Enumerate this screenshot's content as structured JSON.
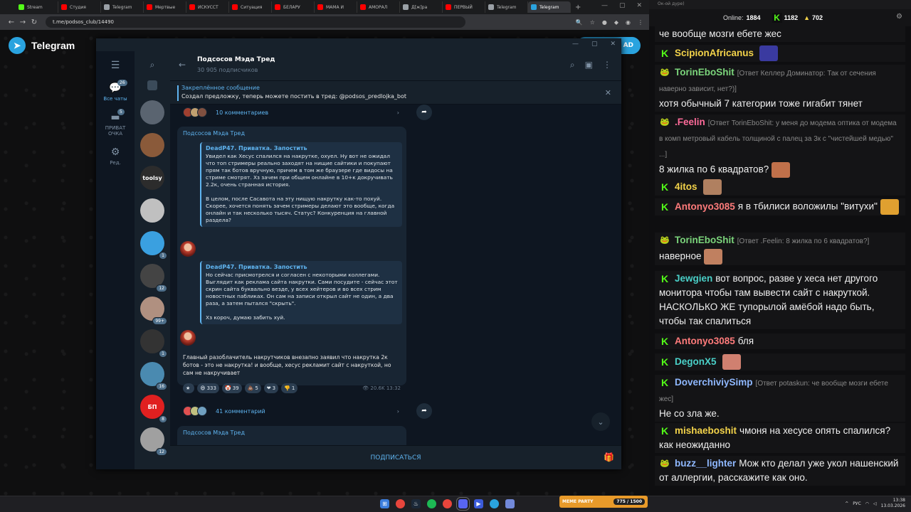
{
  "browser": {
    "tabs": [
      {
        "label": "Stream",
        "color": "#53fc18"
      },
      {
        "label": "Студия",
        "color": "#ff0000"
      },
      {
        "label": "Telegram",
        "color": "#9aa0a6"
      },
      {
        "label": "Мертвые",
        "color": "#ff0000"
      },
      {
        "label": "ИСКУССТ",
        "color": "#ff0000"
      },
      {
        "label": "Ситуация",
        "color": "#ff0000"
      },
      {
        "label": "БЕЛАРУ",
        "color": "#ff0000"
      },
      {
        "label": "МАМА И",
        "color": "#ff0000"
      },
      {
        "label": "АМОРАЛ",
        "color": "#ff0000"
      },
      {
        "label": "Д[ж]ра",
        "color": "#9aa0a6"
      },
      {
        "label": "ПЕРВЫЙ",
        "color": "#ff0000"
      },
      {
        "label": "Telegram",
        "color": "#9aa0a6"
      },
      {
        "label": "Telegram",
        "color": "#2aa3df"
      }
    ],
    "url": "t.me/podsos_club/14490"
  },
  "tg_page": {
    "logo_text": "Telegram",
    "download_label": "AD"
  },
  "folders": [
    {
      "label": "Все чаты",
      "icon": "chats-icon",
      "badge": "26"
    },
    {
      "label": "ПРИВАТ ОЧКА",
      "icon": "folder-icon",
      "badge": "5"
    },
    {
      "label": "Ред.",
      "icon": "edit-icon",
      "badge": ""
    }
  ],
  "chat_avatars": [
    {
      "color": "#5a6470",
      "badge": ""
    },
    {
      "color": "#8a5a3a",
      "badge": ""
    },
    {
      "color": "#2c2c2c",
      "badge": "",
      "text": "toolsy"
    },
    {
      "color": "#c0c0c0",
      "badge": ""
    },
    {
      "color": "#3aa0e0",
      "badge": "1"
    },
    {
      "color": "#444",
      "badge": "12"
    },
    {
      "color": "#b09080",
      "badge": "99+"
    },
    {
      "color": "#333",
      "badge": "1"
    },
    {
      "color": "#4a8ab0",
      "badge": "16"
    },
    {
      "color": "#e02020",
      "badge": "8",
      "text": "БП"
    },
    {
      "color": "#a0a0a0",
      "badge": "12"
    }
  ],
  "chat": {
    "title": "Подсосов Мэда Тред",
    "subscribers": "30 905 подписчиков",
    "pinned_label": "Закреплённое сообщение",
    "pinned_text": "Создал предложку, теперь можете  постить в тред: @podsos_predlojka_bot",
    "comments_top": "10 комментариев",
    "post": {
      "author": "Подсосов Мэда Тред",
      "quote1_author": "DeadP47. Приватка. Запостить",
      "quote1_text": "Увидел как Хесус спалился на накрутке, охуел. Ну вот не ожидал что топ стримеры реально заходят на нищие сайтики и покупают прям так ботов вручную, причем в том же браузере где видосы на стриме смотрят. Хз зачем при общем онлайне в 10+к докручивать 2.2к, очень странная история.\n\nВ целом, после Сасавота на эту нищую накрутку как-то похуй. Скорее, хочется понять зачем стримеры делают это вообще, когда онлайн и так несколько тысяч. Статус? Конкуренция на главной раздела?",
      "quote2_author": "DeadP47. Приватка. Запостить",
      "quote2_text": "Но сейчас присмотрелся и согласен с некоторыми коллегами. Выглядит как реклама сайта накрутки. Сами посудите - сейчас этот скрин сайта буквально везде, у всех хейтеров и во всех стрим новостных пабликах. Он сам на записи открыл сайт не один, а два раза, а затем пытался \"скрыть\".\n\nХз короч, думаю забить хуй.",
      "text": "Главный разоблачитель накрутчиков внезапно заявил что накрутка 2к ботов - это не накрутка! и вообще, хесус рекламит сайт с накруткой, но сам не накручивает",
      "reactions": [
        {
          "emoji": "★",
          "count": ""
        },
        {
          "emoji": "😄",
          "count": "333"
        },
        {
          "emoji": "🤡",
          "count": "39"
        },
        {
          "emoji": "💩",
          "count": "5"
        },
        {
          "emoji": "❤",
          "count": "3"
        },
        {
          "emoji": "👎",
          "count": "1"
        }
      ],
      "views": "20.6K",
      "time": "13:32",
      "comments": "41 комментарий"
    },
    "next_author": "Подсосов Мэда Тред",
    "subscribe_label": "ПОДПИСАТЬСЯ"
  },
  "streamchat": {
    "window_title": "Ок-ой дуре)",
    "online_label": "Online:",
    "online": "1884",
    "kick_count": "1182",
    "other_count": "702",
    "messages": [
      {
        "badge": "",
        "user": "",
        "user_color": "#fff",
        "reply": "",
        "text": "че вообще мозги ебете жес"
      },
      {
        "badge": "kick",
        "user": "ScipionAfricanus",
        "user_color": "#f3d34a",
        "reply": "",
        "text": ""
      },
      {
        "badge": "pepe",
        "user": "TorinEboShit",
        "user_color": "#7bd47b",
        "reply": "[Ответ Келлер Доминатор: Так от сечения наверно зависит, нет?)]",
        "text": "хотя обычный 7 категории тоже гигабит тянет"
      },
      {
        "badge": "pepe",
        "user": ".Feelin",
        "user_color": "#ff6b9a",
        "reply": "[Ответ TorinEboShit: у меня до модема оптика от модема в комп метровый кабель толщиной с палец за 3к с \"чистейшей медью\" ...]",
        "text": "8 жилка по 6 квадратов?"
      },
      {
        "badge": "kick",
        "user": "4itos",
        "user_color": "#f3d34a",
        "reply": "",
        "text": ""
      },
      {
        "badge": "kick",
        "user": "Antonyo3085",
        "user_color": "#ff7b7b",
        "reply": "",
        "text": "я в тбилиси воложилы \"витухи\""
      },
      {
        "badge": "pepe",
        "user": "TorinEboShit",
        "user_color": "#7bd47b",
        "reply": "[Ответ .Feelin: 8 жилка по 6 квадратов?]",
        "text": "наверное"
      },
      {
        "badge": "kick",
        "user": "Jewgien",
        "user_color": "#4ad0c8",
        "reply": "",
        "text": "вот вопрос, разве у хеса нет другого монитора чтобы там вывести сайт с накруткой. НАСКОЛЬКО ЖЕ тупорылой амёбой надо быть, чтобы так спалиться"
      },
      {
        "badge": "kick",
        "user": "Antonyo3085",
        "user_color": "#ff7b7b",
        "reply": "",
        "text": "бля"
      },
      {
        "badge": "kick",
        "user": "DegonX5",
        "user_color": "#4ad0c8",
        "reply": "",
        "text": ""
      },
      {
        "badge": "kick",
        "user": "DoverchiviySimp",
        "user_color": "#8fb8ff",
        "reply": "[Ответ potaskun: че вообще мозги ебете жес]",
        "text": "Не со зла же."
      },
      {
        "badge": "kick",
        "user": "mishaeboshit",
        "user_color": "#f3d34a",
        "reply": "",
        "text": "чмоня на хесусе опять спалился? как неожиданно"
      },
      {
        "badge": "pepe",
        "user": "buzz__lighter",
        "user_color": "#8fb8ff",
        "reply": "",
        "text": "Мож кто делал уже укол нашенский от аллергии, расскажите как оно."
      }
    ]
  },
  "taskbar": {
    "meme_label": "MEME PARTY",
    "meme_count": "775 / 1500",
    "lang": "РУС",
    "time": "13:38",
    "date": "13.03.2026"
  }
}
